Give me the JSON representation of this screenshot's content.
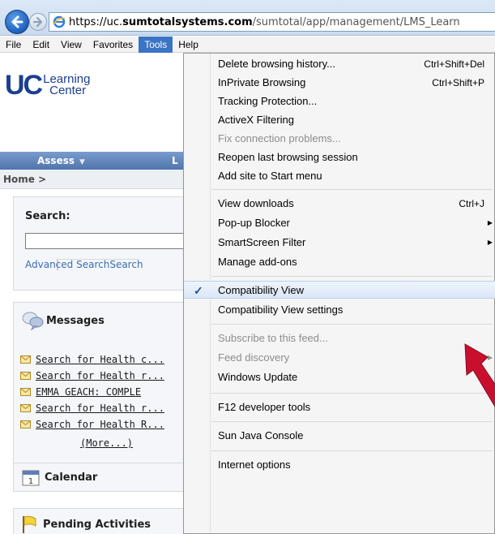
{
  "browser": {
    "url_prefix": "https://uc.",
    "url_host": "sumtotalsystems.com",
    "url_path": "/sumtotal/app/management/LMS_Learn",
    "icons": {
      "back": "back-arrow-icon",
      "forward": "forward-arrow-icon",
      "site": "ie-icon"
    }
  },
  "menubar": {
    "items": [
      "File",
      "Edit",
      "View",
      "Favorites",
      "Tools",
      "Help"
    ],
    "active": "Tools"
  },
  "page": {
    "logo_uc": "UC",
    "logo_line1": "Learning",
    "logo_line2": "Center",
    "nav": {
      "assess": "Assess",
      "second": "L"
    },
    "breadcrumb": "Home >",
    "search": {
      "title": "Search:",
      "value": "",
      "advanced": "Advanced Search",
      "other": "Search"
    },
    "messages": {
      "title": "Messages",
      "items": [
        "Search for Health c...",
        "Search for Health r...",
        "EMMA GEACH: COMPLE",
        "Search for Health r...",
        "Search for Health R..."
      ],
      "more": "(More...)"
    },
    "calendar": {
      "title": "Calendar"
    },
    "pending": {
      "title": "Pending Activities"
    }
  },
  "tools_menu": {
    "items": [
      {
        "label": "Delete browsing history...",
        "accel": "Ctrl+Shift+Del"
      },
      {
        "label": "InPrivate Browsing",
        "accel": "Ctrl+Shift+P"
      },
      {
        "label": "Tracking Protection...",
        "accel": ""
      },
      {
        "label": "ActiveX Filtering",
        "accel": ""
      },
      {
        "label": "Fix connection problems...",
        "accel": "",
        "disabled": true
      },
      {
        "label": "Reopen last browsing session",
        "accel": ""
      },
      {
        "label": "Add site to Start menu",
        "accel": ""
      },
      {
        "label": "View downloads",
        "accel": "Ctrl+J"
      },
      {
        "label": "Pop-up Blocker",
        "accel": "",
        "submenu": true
      },
      {
        "label": "SmartScreen Filter",
        "accel": "",
        "submenu": true
      },
      {
        "label": "Manage add-ons",
        "accel": ""
      },
      {
        "label": "Compatibility View",
        "accel": "",
        "checked": true
      },
      {
        "label": "Compatibility View settings",
        "accel": ""
      },
      {
        "label": "Subscribe to this feed...",
        "accel": "",
        "disabled": true
      },
      {
        "label": "Feed discovery",
        "accel": "",
        "disabled": true,
        "submenu": true
      },
      {
        "label": "Windows Update",
        "accel": ""
      },
      {
        "label": "F12 developer tools",
        "accel": ""
      },
      {
        "label": "Sun Java Console",
        "accel": ""
      },
      {
        "label": "Internet options",
        "accel": ""
      }
    ]
  },
  "colors": {
    "nav_bar": "#4f74ad",
    "menu_highlight": "#3a74c4",
    "logo_blue": "#1b3f8f",
    "annotation_arrow": "#c8102e"
  }
}
